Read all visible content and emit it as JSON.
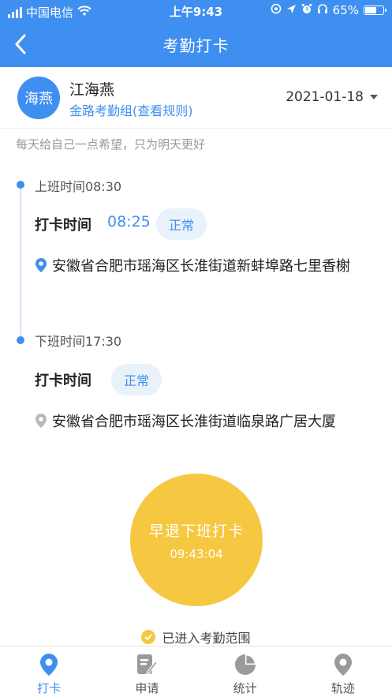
{
  "status_bar": {
    "carrier": "中国电信",
    "time": "上午9:43",
    "battery": "65%",
    "battery_level": 0.65
  },
  "navbar": {
    "title": "考勤打卡"
  },
  "user": {
    "avatar_text": "海燕",
    "name": "江海燕",
    "group": "金路考勤组(查看规则)",
    "date": "2021-01-18"
  },
  "motto": "每天给自己一点希望，只为明天更好",
  "checkin": {
    "shift_label": "上班时间08:30",
    "punch_label": "打卡时间",
    "punch_time": "08:25",
    "status": "正常",
    "address": "安徽省合肥市瑶海区长淮街道新蚌埠路七里香榭"
  },
  "checkout": {
    "shift_label": "下班时间17:30",
    "punch_label": "打卡时间",
    "status": "正常",
    "address": "安徽省合肥市瑶海区长淮街道临泉路广居大厦"
  },
  "punch_button": {
    "label": "早退下班打卡",
    "time": "09:43:04"
  },
  "range_status": "已进入考勤范围",
  "tabs": [
    {
      "label": "打卡",
      "icon": "location-pin-icon",
      "active": true
    },
    {
      "label": "申请",
      "icon": "form-edit-icon",
      "active": false
    },
    {
      "label": "统计",
      "icon": "pie-chart-icon",
      "active": false
    },
    {
      "label": "轨迹",
      "icon": "map-pin-icon",
      "active": false
    }
  ],
  "colors": {
    "primary": "#3f8ff0",
    "accent": "#f6c740",
    "badge_bg": "#e9f1fb",
    "inactive_icon": "#9a9a9a"
  }
}
